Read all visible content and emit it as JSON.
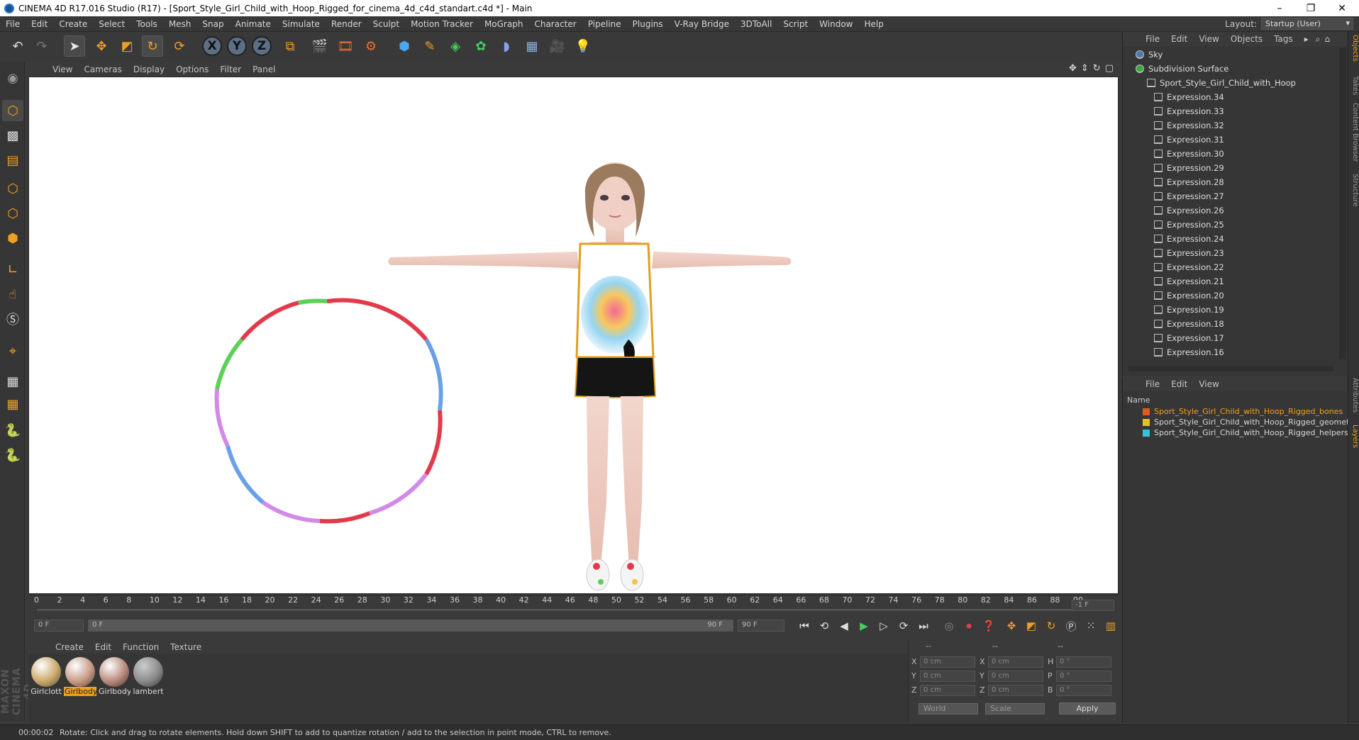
{
  "window": {
    "title": "CINEMA 4D R17.016 Studio (R17) - [Sport_Style_Girl_Child_with_Hoop_Rigged_for_cinema_4d_c4d_standart.c4d *] - Main",
    "controls": [
      "–",
      "❐",
      "✕"
    ]
  },
  "menu": [
    "File",
    "Edit",
    "Create",
    "Select",
    "Tools",
    "Mesh",
    "Snap",
    "Animate",
    "Simulate",
    "Render",
    "Sculpt",
    "Motion Tracker",
    "MoGraph",
    "Character",
    "Pipeline",
    "Plugins",
    "V-Ray Bridge",
    "3DToAll",
    "Script",
    "Window",
    "Help"
  ],
  "layout": {
    "label": "Layout:",
    "value": "Startup (User)"
  },
  "toolbar": {
    "axes": [
      "X",
      "Y",
      "Z"
    ],
    "icons": [
      "undo-icon",
      "redo-icon",
      "select-arrow-icon",
      "move-icon",
      "scale-icon",
      "rotate-icon",
      "rotate-alt-icon",
      "coordinate-system-icon",
      "render-view-icon",
      "render-picture-viewer-icon",
      "edit-render-settings-icon",
      "cube-icon",
      "pen-icon",
      "subdivision-icon",
      "cloner-icon",
      "deformer-icon",
      "floor-icon",
      "camera-icon",
      "light-icon"
    ]
  },
  "viewport": {
    "menu": [
      "View",
      "Cameras",
      "Display",
      "Options",
      "Filter",
      "Panel"
    ]
  },
  "timeline": {
    "ticks": [
      "0",
      "2",
      "4",
      "6",
      "8",
      "10",
      "12",
      "14",
      "16",
      "18",
      "20",
      "22",
      "24",
      "26",
      "28",
      "30",
      "32",
      "34",
      "36",
      "38",
      "40",
      "42",
      "44",
      "46",
      "48",
      "50",
      "52",
      "54",
      "56",
      "58",
      "60",
      "62",
      "64",
      "66",
      "68",
      "70",
      "72",
      "74",
      "76",
      "78",
      "80",
      "82",
      "84",
      "86",
      "88",
      "90"
    ],
    "current_frame": "-1 F",
    "start_field": "0 F",
    "range_start": "0 F",
    "range_end": "90 F",
    "end_field": "90 F"
  },
  "materials": {
    "menu": [
      "Create",
      "Edit",
      "Function",
      "Texture"
    ],
    "items": [
      {
        "name": "Girlclott",
        "selected": false,
        "color": "#caa86a"
      },
      {
        "name": "Girlbody",
        "selected": true,
        "color": "#c79a86"
      },
      {
        "name": "Girlbody",
        "selected": false,
        "color": "#b88a7c"
      },
      {
        "name": "lambert",
        "selected": false,
        "color": "#8a8a8a"
      }
    ]
  },
  "coords": {
    "headers": [
      "--",
      "--",
      "--"
    ],
    "rows": [
      {
        "a": "X",
        "av": "0 cm",
        "b": "X",
        "bv": "0 cm",
        "c": "H",
        "cv": "0 °"
      },
      {
        "a": "Y",
        "av": "0 cm",
        "b": "Y",
        "bv": "0 cm",
        "c": "P",
        "cv": "0 °"
      },
      {
        "a": "Z",
        "av": "0 cm",
        "b": "Z",
        "bv": "0 cm",
        "c": "B",
        "cv": "0 °"
      }
    ],
    "world": "World",
    "scale": "Scale",
    "apply": "Apply"
  },
  "status": {
    "time": "00:00:02",
    "message": "Rotate: Click and drag to rotate elements. Hold down SHIFT to add to quantize rotation / add to the selection in point mode, CTRL to remove."
  },
  "objects": {
    "menu": [
      "File",
      "Edit",
      "View",
      "Objects",
      "Tags"
    ],
    "items": [
      {
        "name": "Sky",
        "level": 0
      },
      {
        "name": "Subdivision Surface",
        "level": 0
      },
      {
        "name": "Sport_Style_Girl_Child_with_Hoop",
        "level": 1
      },
      {
        "name": "Expression.34",
        "level": 2
      },
      {
        "name": "Expression.33",
        "level": 2
      },
      {
        "name": "Expression.32",
        "level": 2
      },
      {
        "name": "Expression.31",
        "level": 2
      },
      {
        "name": "Expression.30",
        "level": 2
      },
      {
        "name": "Expression.29",
        "level": 2
      },
      {
        "name": "Expression.28",
        "level": 2
      },
      {
        "name": "Expression.27",
        "level": 2
      },
      {
        "name": "Expression.26",
        "level": 2
      },
      {
        "name": "Expression.25",
        "level": 2
      },
      {
        "name": "Expression.24",
        "level": 2
      },
      {
        "name": "Expression.23",
        "level": 2
      },
      {
        "name": "Expression.22",
        "level": 2
      },
      {
        "name": "Expression.21",
        "level": 2
      },
      {
        "name": "Expression.20",
        "level": 2
      },
      {
        "name": "Expression.19",
        "level": 2
      },
      {
        "name": "Expression.18",
        "level": 2
      },
      {
        "name": "Expression.17",
        "level": 2
      },
      {
        "name": "Expression.16",
        "level": 2
      }
    ]
  },
  "layers": {
    "menu": [
      "File",
      "Edit",
      "View"
    ],
    "header": "Name",
    "items": [
      {
        "name": "Sport_Style_Girl_Child_with_Hoop_Rigged_bones",
        "color": "#e05a1e",
        "text": "#f0a020"
      },
      {
        "name": "Sport_Style_Girl_Child_with_Hoop_Rigged_geometry",
        "color": "#e8c21a",
        "text": "#d8d8d8"
      },
      {
        "name": "Sport_Style_Girl_Child_with_Hoop_Rigged_helpers",
        "color": "#2fc4d6",
        "text": "#d8d8d8"
      }
    ]
  },
  "right_tabs": [
    "Objects",
    "Takes",
    "Content Browser",
    "Structure",
    "Attributes",
    "Layers"
  ]
}
